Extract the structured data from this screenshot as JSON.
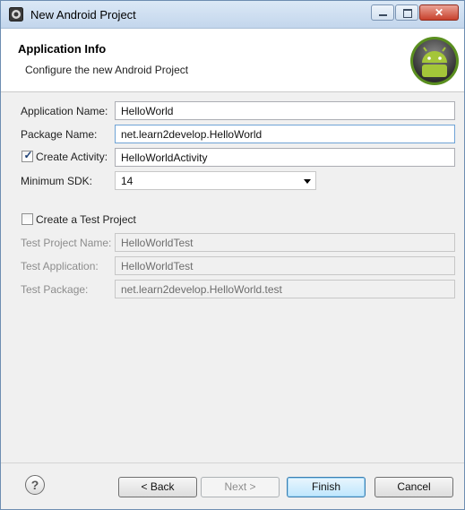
{
  "window": {
    "title": "New Android Project"
  },
  "header": {
    "title": "Application Info",
    "subtitle": "Configure the new Android Project",
    "logo_icon": "android-icon"
  },
  "form": {
    "application_name": {
      "label": "Application Name:",
      "value": "HelloWorld"
    },
    "package_name": {
      "label": "Package Name:",
      "value": "net.learn2develop.HelloWorld"
    },
    "create_activity": {
      "label": "Create Activity:",
      "checked": true,
      "value": "HelloWorldActivity"
    },
    "minimum_sdk": {
      "label": "Minimum SDK:",
      "value": "14"
    },
    "create_test_project": {
      "label": "Create a Test Project",
      "checked": false
    },
    "test_project_name": {
      "label": "Test Project Name:",
      "value": "HelloWorldTest"
    },
    "test_application": {
      "label": "Test Application:",
      "value": "HelloWorldTest"
    },
    "test_package": {
      "label": "Test Package:",
      "value": "net.learn2develop.HelloWorld.test"
    }
  },
  "buttons": {
    "help_icon": "help-icon",
    "back": "< Back",
    "next": "Next >",
    "finish": "Finish",
    "cancel": "Cancel"
  },
  "colors": {
    "android_green": "#a4c639",
    "title_bar": "#c3d6ec",
    "close_red": "#c8412c"
  }
}
